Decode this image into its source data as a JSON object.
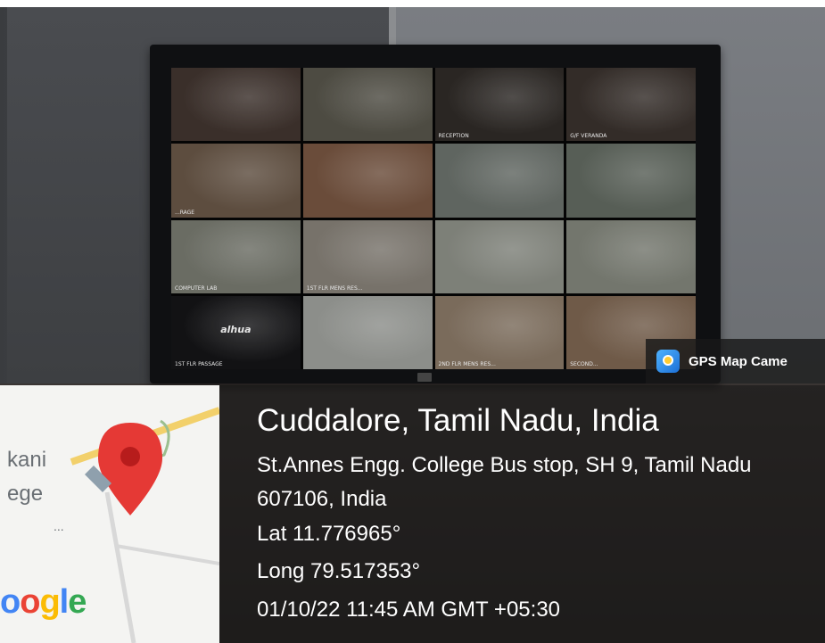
{
  "colors": {
    "overlay_text": "#ffffff",
    "pin": "#e53935",
    "road": "#f2d06b"
  },
  "camera_grid": [
    {
      "label": "",
      "bg": "#3a2f2a"
    },
    {
      "label": "",
      "bg": "#4d4b42"
    },
    {
      "label": "RECEPTION",
      "bg": "#2a2623"
    },
    {
      "label": "G/F VERANDA",
      "bg": "#332c28"
    },
    {
      "label": "...RAGE",
      "bg": "#5d4d3f"
    },
    {
      "label": "",
      "bg": "#6a4c3a"
    },
    {
      "label": "",
      "bg": "#5f6560"
    },
    {
      "label": "",
      "bg": "#575e56"
    },
    {
      "label": "COMPUTER LAB",
      "bg": "#6a6c63"
    },
    {
      "label": "1ST FLR MENS RES...",
      "bg": "#77726a"
    },
    {
      "label": "",
      "bg": "#7d8078"
    },
    {
      "label": "",
      "bg": "#73766d"
    },
    {
      "label": "1ST FLR PASSAGE",
      "bg": "#121214"
    },
    {
      "label": "",
      "bg": "#8c8e8a"
    },
    {
      "label": "2ND FLR MENS RES...",
      "bg": "#7a6b5b"
    },
    {
      "label": "SECOND...",
      "bg": "#6f5a48"
    }
  ],
  "camera_brand": "alhua",
  "gps_badge": {
    "label": "GPS Map Came",
    "icon": "gps-map-camera-icon"
  },
  "location": {
    "title": "Cuddalore, Tamil Nadu, India",
    "address": "St.Annes Engg. College Bus stop, SH 9, Tamil Nadu 607106, India",
    "lat": "Lat 11.776965°",
    "long": "Long 79.517353°",
    "datetime": "01/10/22 11:45 AM GMT +05:30"
  },
  "map": {
    "text_1": "kani",
    "text_2": "ege",
    "text_3": "...",
    "brand": "Google"
  }
}
